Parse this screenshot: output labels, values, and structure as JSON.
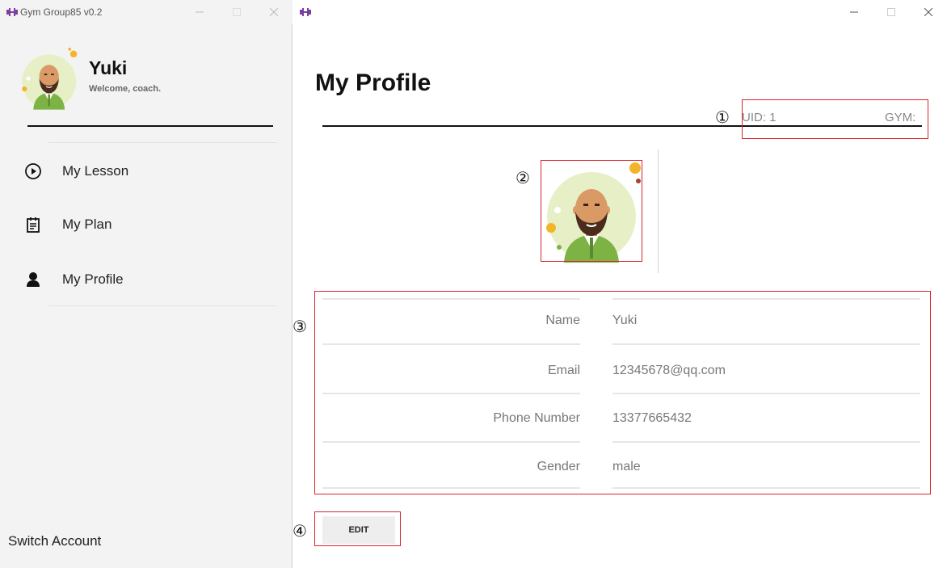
{
  "left_window": {
    "title": "Gym Group85 v0.2",
    "user": {
      "name": "Yuki",
      "welcome": "Welcome, coach."
    },
    "nav": [
      {
        "label": "My Lesson",
        "icon": "play-circle-icon"
      },
      {
        "label": "My Plan",
        "icon": "clipboard-icon"
      },
      {
        "label": "My Profile",
        "icon": "person-icon"
      }
    ],
    "switch_account": "Switch Account"
  },
  "right_window": {
    "page_title": "My Profile",
    "uid_label": "UID: 1",
    "gym_label": "GYM:",
    "profile": [
      {
        "label": "Name",
        "value": "Yuki"
      },
      {
        "label": "Email",
        "value": "12345678@qq.com"
      },
      {
        "label": "Phone Number",
        "value": "13377665432"
      },
      {
        "label": "Gender",
        "value": "male"
      }
    ],
    "edit_label": "EDIT"
  },
  "annotations": [
    "①",
    "②",
    "③",
    "④"
  ],
  "colors": {
    "annotation": "#d9252e",
    "app_icon": "#7b3fa0",
    "avatar_bg": "#e6efc6",
    "jacket": "#7db344"
  }
}
